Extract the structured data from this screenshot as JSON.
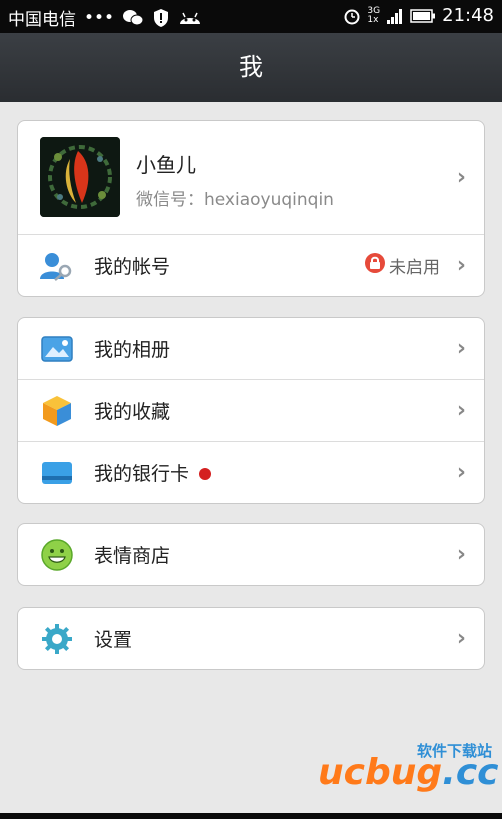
{
  "status_bar": {
    "carrier": "中国电信",
    "dots": "•••",
    "network": "3G",
    "network_sub": "1x",
    "time": "21:48"
  },
  "title": "我",
  "profile": {
    "name": "小鱼儿",
    "wechat_id": "微信号：hexiaoyuqinqin"
  },
  "account": {
    "label": "我的帐号",
    "status": "未启用"
  },
  "group2": [
    {
      "label": "我的相册",
      "icon": "photo-album-icon"
    },
    {
      "label": "我的收藏",
      "icon": "favorites-cube-icon"
    },
    {
      "label": "我的银行卡",
      "icon": "bank-card-icon"
    }
  ],
  "sticker_store": {
    "label": "表情商店",
    "icon": "smiley-icon"
  },
  "settings": {
    "label": "设置",
    "icon": "gear-icon"
  },
  "watermark": {
    "top_text": "软件下载站",
    "logo_orange": "ucbug",
    "logo_blue": ".cc"
  },
  "colors": {
    "accent_red": "#d42020",
    "titlebar": "#2f3236",
    "background": "#e8e8e8"
  }
}
